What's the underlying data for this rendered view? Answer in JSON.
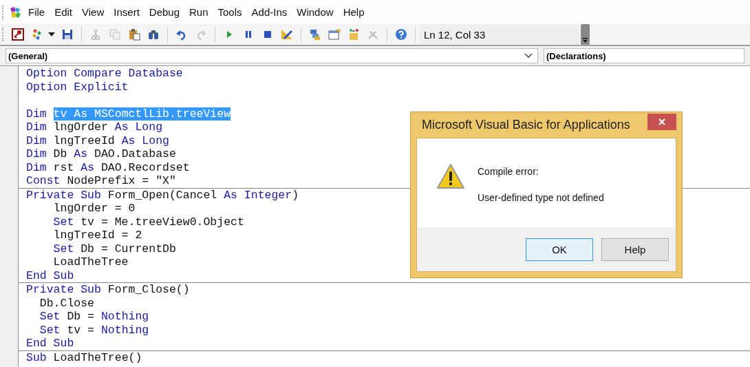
{
  "menu": [
    {
      "label": "File"
    },
    {
      "label": "Edit"
    },
    {
      "label": "View"
    },
    {
      "label": "Insert"
    },
    {
      "label": "Debug"
    },
    {
      "label": "Run"
    },
    {
      "label": "Tools"
    },
    {
      "label": "Add-Ins"
    },
    {
      "label": "Window"
    },
    {
      "label": "Help"
    }
  ],
  "toolbar": [
    {
      "kind": "access",
      "disabled": false
    },
    {
      "kind": "insert",
      "disabled": false
    },
    {
      "kind": "caret",
      "disabled": false
    },
    {
      "kind": "save",
      "disabled": false
    },
    {
      "kind": "separator"
    },
    {
      "kind": "cut",
      "disabled": true
    },
    {
      "kind": "copy",
      "disabled": true
    },
    {
      "kind": "paste",
      "disabled": false
    },
    {
      "kind": "find",
      "disabled": false
    },
    {
      "kind": "separator"
    },
    {
      "kind": "undo",
      "disabled": false
    },
    {
      "kind": "redo",
      "disabled": true
    },
    {
      "kind": "separator"
    },
    {
      "kind": "run",
      "disabled": false
    },
    {
      "kind": "break",
      "disabled": false
    },
    {
      "kind": "reset",
      "disabled": false
    },
    {
      "kind": "design",
      "disabled": false
    },
    {
      "kind": "separator"
    },
    {
      "kind": "project",
      "disabled": false
    },
    {
      "kind": "properties",
      "disabled": false
    },
    {
      "kind": "browser",
      "disabled": false
    },
    {
      "kind": "toolbox",
      "disabled": true
    },
    {
      "kind": "separator"
    },
    {
      "kind": "help",
      "disabled": false
    }
  ],
  "cursor_position": "Ln 12, Col 33",
  "object_box": {
    "value": "(General)"
  },
  "procedure_box": {
    "value": "(Declarations)"
  },
  "code": [
    {
      "lines": [
        {
          "kind": "code",
          "segments": [
            {
              "text": "Option Compare Database",
              "kind": "keyword"
            }
          ]
        },
        {
          "kind": "code",
          "segments": [
            {
              "text": "Option Explicit",
              "kind": "keyword"
            }
          ]
        },
        {
          "kind": "blank"
        },
        {
          "kind": "code",
          "segments": [
            {
              "text": "Dim ",
              "kind": "keyword"
            },
            {
              "text": "tv As MSComctlLib.treeView",
              "kind": "selected"
            }
          ]
        },
        {
          "kind": "code",
          "segments": [
            {
              "text": "Dim",
              "kind": "keyword"
            },
            {
              "text": " lngOrder ",
              "kind": "plain"
            },
            {
              "text": "As Long",
              "kind": "keyword"
            }
          ]
        },
        {
          "kind": "code",
          "segments": [
            {
              "text": "Dim",
              "kind": "keyword"
            },
            {
              "text": " lngTreeId ",
              "kind": "plain"
            },
            {
              "text": "As Long",
              "kind": "keyword"
            }
          ]
        },
        {
          "kind": "code",
          "segments": [
            {
              "text": "Dim",
              "kind": "keyword"
            },
            {
              "text": " Db ",
              "kind": "plain"
            },
            {
              "text": "As",
              "kind": "keyword"
            },
            {
              "text": " DAO.Database",
              "kind": "plain"
            }
          ]
        },
        {
          "kind": "code",
          "segments": [
            {
              "text": "Dim",
              "kind": "keyword"
            },
            {
              "text": " rst ",
              "kind": "plain"
            },
            {
              "text": "As",
              "kind": "keyword"
            },
            {
              "text": " DAO.Recordset",
              "kind": "plain"
            }
          ]
        },
        {
          "kind": "code",
          "segments": [
            {
              "text": "Const",
              "kind": "keyword"
            },
            {
              "text": " NodePrefix = \"X\"",
              "kind": "plain"
            }
          ]
        }
      ]
    },
    {
      "lines": [
        {
          "kind": "code",
          "segments": [
            {
              "text": "Private Sub",
              "kind": "keyword"
            },
            {
              "text": " Form_Open(Cancel ",
              "kind": "plain"
            },
            {
              "text": "As Integer",
              "kind": "keyword"
            },
            {
              "text": ")",
              "kind": "plain"
            }
          ]
        },
        {
          "kind": "code",
          "segments": [
            {
              "text": "    lngOrder = 0",
              "kind": "plain"
            }
          ]
        },
        {
          "kind": "code",
          "segments": [
            {
              "text": "    Set",
              "kind": "keyword"
            },
            {
              "text": " tv = Me.treeView0.Object",
              "kind": "plain"
            }
          ]
        },
        {
          "kind": "code",
          "segments": [
            {
              "text": "    lngTreeId = 2",
              "kind": "plain"
            }
          ]
        },
        {
          "kind": "code",
          "segments": [
            {
              "text": "    Set",
              "kind": "keyword"
            },
            {
              "text": " Db = CurrentDb",
              "kind": "plain"
            }
          ]
        },
        {
          "kind": "code",
          "segments": [
            {
              "text": "    LoadTheTree",
              "kind": "plain"
            }
          ]
        },
        {
          "kind": "code",
          "segments": [
            {
              "text": "End Sub",
              "kind": "keyword"
            }
          ]
        }
      ]
    },
    {
      "lines": [
        {
          "kind": "code",
          "segments": [
            {
              "text": "Private Sub",
              "kind": "keyword"
            },
            {
              "text": " Form_Close()",
              "kind": "plain"
            }
          ]
        },
        {
          "kind": "code",
          "segments": [
            {
              "text": "  Db.Close",
              "kind": "plain"
            }
          ]
        },
        {
          "kind": "code",
          "segments": [
            {
              "text": "  Set",
              "kind": "keyword"
            },
            {
              "text": " Db = ",
              "kind": "plain"
            },
            {
              "text": "Nothing",
              "kind": "keyword"
            }
          ]
        },
        {
          "kind": "code",
          "segments": [
            {
              "text": "  Set",
              "kind": "keyword"
            },
            {
              "text": " tv = ",
              "kind": "plain"
            },
            {
              "text": "Nothing",
              "kind": "keyword"
            }
          ]
        },
        {
          "kind": "code",
          "segments": [
            {
              "text": "End Sub",
              "kind": "keyword"
            }
          ]
        }
      ]
    },
    {
      "lines": [
        {
          "kind": "code",
          "segments": [
            {
              "text": "Sub",
              "kind": "keyword"
            },
            {
              "text": " LoadTheTree()",
              "kind": "plain"
            }
          ]
        }
      ]
    }
  ],
  "dialog": {
    "title": "Microsoft Visual Basic for Applications",
    "heading": "Compile error:",
    "message": "User-defined type not defined",
    "buttons": [
      {
        "label": "OK",
        "selected": true
      },
      {
        "label": "Help",
        "selected": false
      }
    ]
  }
}
